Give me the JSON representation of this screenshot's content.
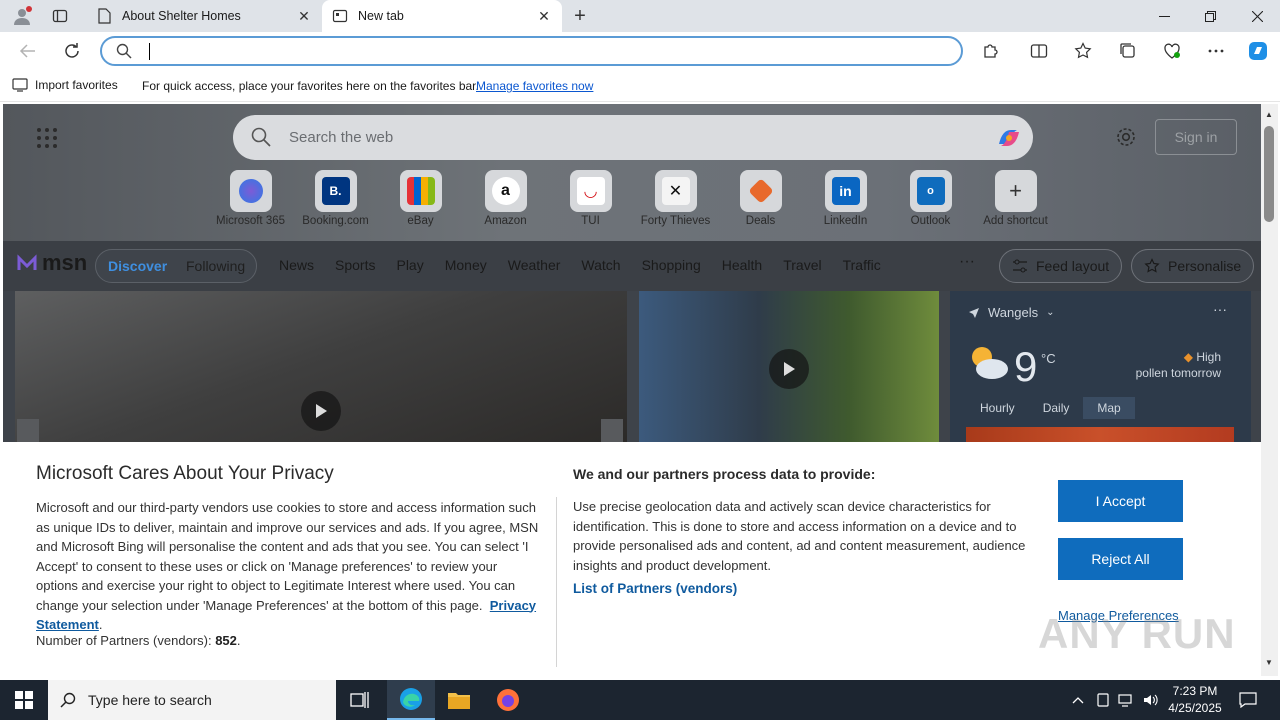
{
  "browser": {
    "tabs": [
      {
        "title": "About Shelter Homes",
        "active": false
      },
      {
        "title": "New tab",
        "active": true
      }
    ],
    "window_controls": {
      "minimize": "minimize-icon",
      "restore": "restore-icon",
      "close": "close-icon"
    },
    "address_bar": {
      "value": "",
      "placeholder": ""
    },
    "favorites_bar": {
      "import_label": "Import favorites",
      "hint": "For quick access, place your favorites here on the favorites bar.",
      "manage_link": "Manage favorites now"
    }
  },
  "newtab": {
    "search_placeholder": "Search the web",
    "sign_in": "Sign in",
    "shortcuts": [
      {
        "label": "Microsoft 365",
        "icon": "microsoft365-icon"
      },
      {
        "label": "Booking.com",
        "icon": "booking-icon"
      },
      {
        "label": "eBay",
        "icon": "ebay-icon"
      },
      {
        "label": "Amazon",
        "icon": "amazon-icon"
      },
      {
        "label": "TUI",
        "icon": "tui-icon"
      },
      {
        "label": "Forty Thieves",
        "icon": "forty-thieves-icon"
      },
      {
        "label": "Deals",
        "icon": "deals-icon"
      },
      {
        "label": "LinkedIn",
        "icon": "linkedin-icon"
      },
      {
        "label": "Outlook",
        "icon": "outlook-icon"
      },
      {
        "label": "Add shortcut",
        "icon": "plus-icon"
      }
    ],
    "msn": {
      "logo": "msn",
      "discover": "Discover",
      "following": "Following",
      "nav": [
        "News",
        "Sports",
        "Play",
        "Money",
        "Weather",
        "Watch",
        "Shopping",
        "Health",
        "Travel",
        "Traffic"
      ],
      "more": "···",
      "feed_layout": "Feed layout",
      "personalise": "Personalise"
    },
    "weather": {
      "location": "Wangels",
      "temp": "9",
      "unit": "°C",
      "pollen_level": "High",
      "pollen_text": "pollen tomorrow",
      "tabs": [
        "Hourly",
        "Daily",
        "Map"
      ],
      "active_tab": "Map"
    }
  },
  "privacy": {
    "title": "Microsoft Cares About Your Privacy",
    "body": "Microsoft and our third-party vendors use cookies to store and access information such as unique IDs to deliver, maintain and improve our services and ads. If you agree, MSN and Microsoft Bing will personalise the content and ads that you see. You can select 'I Accept' to consent to these uses or click on 'Manage preferences' to review your options and exercise your right to object to Legitimate Interest where used.  You can change your selection under 'Manage Preferences' at the bottom of this page.",
    "privacy_link": "Privacy Statement",
    "partners_label": "Number of Partners (vendors):",
    "partners_count": "852",
    "right_title": "We and our partners process data to provide:",
    "right_body": "Use precise geolocation data and actively scan device characteristics for identification. This is done to store and access information on a device and to provide personalised ads and content, ad and content measurement, audience insights and product development.",
    "vendors_link": "List of Partners (vendors)",
    "accept": "I Accept",
    "reject": "Reject All",
    "manage": "Manage Preferences"
  },
  "taskbar": {
    "search_placeholder": "Type here to search",
    "time": "7:23 PM",
    "date": "4/25/2025"
  },
  "watermark": "ANY RUN",
  "colors": {
    "accent": "#0f6cbd",
    "link": "#0f5a9e",
    "taskbar": "#1c2530"
  }
}
